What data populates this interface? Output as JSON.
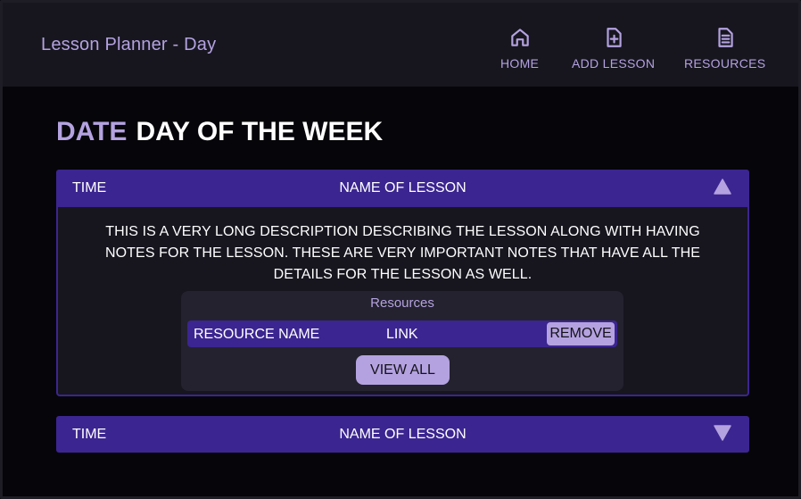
{
  "app": {
    "title": "Lesson Planner - Day"
  },
  "nav": {
    "home_label": "HOME",
    "add_lesson_label": "ADD LESSON",
    "resources_label": "RESOURCES"
  },
  "page": {
    "date_label": "DATE",
    "day_label": "DAY OF THE WEEK"
  },
  "lessons": [
    {
      "time": "TIME",
      "name": "NAME OF LESSON",
      "expanded": true,
      "description": "THIS IS A VERY LONG DESCRIPTION DESCRIBING THE LESSON ALONG WITH HAVING NOTES FOR THE LESSON. THESE ARE VERY IMPORTANT NOTES THAT HAVE ALL THE DETAILS FOR THE LESSON AS WELL.",
      "resources": {
        "title": "Resources",
        "items": [
          {
            "name": "RESOURCE NAME",
            "link": "LINK",
            "remove_label": "REMOVE"
          }
        ],
        "view_all_label": "VIEW ALL"
      }
    },
    {
      "time": "TIME",
      "name": "NAME OF LESSON",
      "expanded": false
    }
  ],
  "icons": {
    "home": "home-icon",
    "add_lesson": "file-plus-icon",
    "resources": "file-text-icon",
    "collapse": "triangle-up-icon",
    "expand": "triangle-down-icon"
  },
  "colors": {
    "background": "#060509",
    "navbar": "#17161f",
    "accent": "#b4a2e0",
    "primary": "#3b2590",
    "panel": "#24222e"
  }
}
